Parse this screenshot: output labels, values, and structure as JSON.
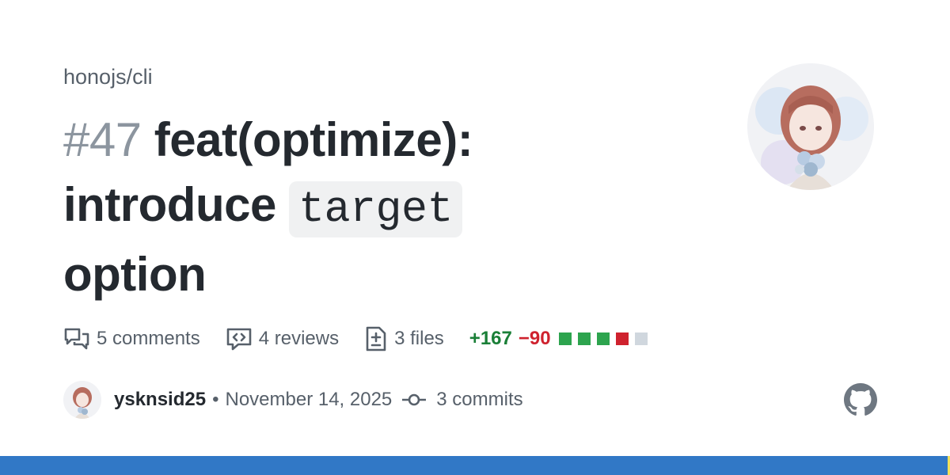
{
  "repo": "honojs/cli",
  "pr": {
    "number": "#47",
    "title_part1": "feat(optimize): introduce",
    "title_code": "target",
    "title_part2": "option"
  },
  "stats": {
    "comments": "5 comments",
    "reviews": "4 reviews",
    "files": "3 files",
    "additions": "+167",
    "deletions": "−90",
    "diff_blocks": [
      "added",
      "added",
      "added",
      "deleted",
      "neutral"
    ]
  },
  "author": {
    "name": "ysknsid25",
    "separator": "•",
    "date": "November 14, 2025",
    "commits": "3 commits"
  },
  "icons": {
    "comments": "comment-discussion-icon",
    "reviews": "code-review-icon",
    "files": "file-diff-icon",
    "commits": "git-commit-icon",
    "brand": "github-mark-icon"
  },
  "colors": {
    "added": "#2da44e",
    "deleted": "#cf222e",
    "neutral": "#d0d7de",
    "language_bar": "#3178c6",
    "language_bar_edge": "#f1e05a"
  }
}
